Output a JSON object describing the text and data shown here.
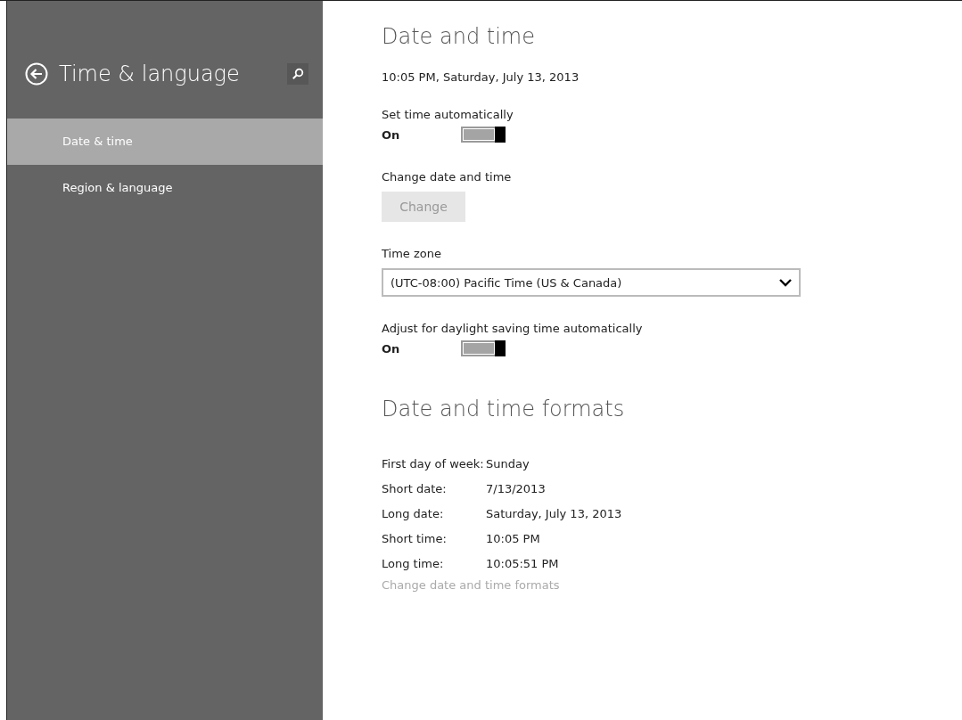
{
  "sidebar": {
    "title": "Time & language",
    "items": [
      {
        "label": "Date & time",
        "selected": true
      },
      {
        "label": "Region & language",
        "selected": false
      }
    ]
  },
  "main": {
    "heading": "Date and time",
    "current": "10:05 PM, Saturday, July 13, 2013",
    "settings": [
      {
        "kind": "toggle",
        "label": "Set time automatically",
        "state_text": "On",
        "on": true
      },
      {
        "kind": "button",
        "label": "Change date and time",
        "button": "Change",
        "disabled": true
      },
      {
        "kind": "dropdown",
        "label": "Time zone",
        "value": "(UTC-08:00) Pacific Time (US & Canada)"
      },
      {
        "kind": "toggle",
        "label": "Adjust for daylight saving time automatically",
        "state_text": "On",
        "on": true
      }
    ],
    "formats_heading": "Date and time formats",
    "formats": [
      {
        "label": "First day of week:",
        "value": "Sunday"
      },
      {
        "label": "Short date:",
        "value": "7/13/2013"
      },
      {
        "label": "Long date:",
        "value": "Saturday, July 13, 2013"
      },
      {
        "label": "Short time:",
        "value": "10:05 PM"
      },
      {
        "label": "Long time:",
        "value": "10:05:51 PM"
      }
    ],
    "link": "Change date and time formats"
  }
}
